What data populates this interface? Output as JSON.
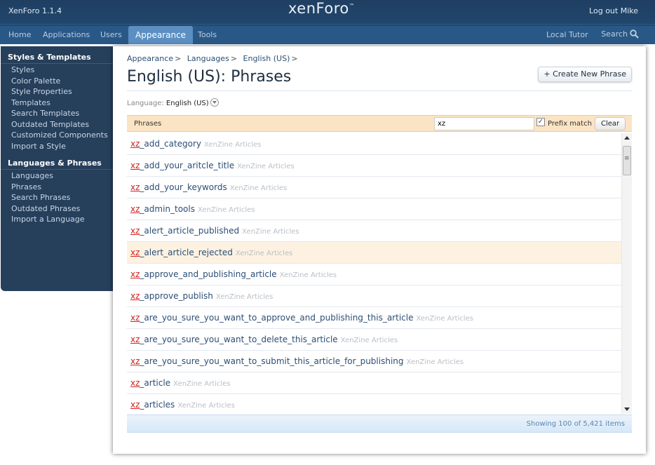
{
  "app": {
    "title": "XenForo 1.1.4",
    "logo": "xenForo",
    "logo_mark": "™",
    "logout": "Log out Mike"
  },
  "tabs": [
    {
      "label": "Home",
      "selected": false
    },
    {
      "label": "Applications",
      "selected": false
    },
    {
      "label": "Users",
      "selected": false
    },
    {
      "label": "Appearance",
      "selected": true
    },
    {
      "label": "Tools",
      "selected": false
    }
  ],
  "header_right": {
    "local_tutor": "Local Tutor",
    "search": "Search"
  },
  "sidebar": {
    "groups": [
      {
        "heading": "Styles & Templates",
        "items": [
          "Styles",
          "Color Palette",
          "Style Properties",
          "Templates",
          "Search Templates",
          "Outdated Templates",
          "Customized Components",
          "Import a Style"
        ]
      },
      {
        "heading": "Languages & Phrases",
        "items": [
          "Languages",
          "Phrases",
          "Search Phrases",
          "Outdated Phrases",
          "Import a Language"
        ]
      }
    ]
  },
  "breadcrumb": [
    "Appearance",
    "Languages",
    "English (US)"
  ],
  "breadcrumb_sep": ">",
  "page_title": "English (US): Phrases",
  "create_button": "+ Create New Phrase",
  "language": {
    "label": "Language:",
    "value": "English (US)"
  },
  "filter": {
    "label": "Phrases",
    "value": "xz",
    "prefix_checked": true,
    "prefix_label": "Prefix match",
    "clear": "Clear"
  },
  "phrases": [
    {
      "prefix": "xz",
      "rest": "_add_category",
      "addon": "XenZine Articles",
      "highlighted": false
    },
    {
      "prefix": "xz",
      "rest": "_add_your_aritcle_title",
      "addon": "XenZine Articles",
      "highlighted": false
    },
    {
      "prefix": "xz",
      "rest": "_add_your_keywords",
      "addon": "XenZine Articles",
      "highlighted": false
    },
    {
      "prefix": "xz",
      "rest": "_admin_tools",
      "addon": "XenZine Articles",
      "highlighted": false
    },
    {
      "prefix": "xz",
      "rest": "_alert_article_published",
      "addon": "XenZine Articles",
      "highlighted": false
    },
    {
      "prefix": "xz",
      "rest": "_alert_article_rejected",
      "addon": "XenZine Articles",
      "highlighted": true
    },
    {
      "prefix": "xz",
      "rest": "_approve_and_publishing_article",
      "addon": "XenZine Articles",
      "highlighted": false
    },
    {
      "prefix": "xz",
      "rest": "_approve_publish",
      "addon": "XenZine Articles",
      "highlighted": false
    },
    {
      "prefix": "xz",
      "rest": "_are_you_sure_you_want_to_approve_and_publishing_this_article",
      "addon": "XenZine Articles",
      "highlighted": false
    },
    {
      "prefix": "xz",
      "rest": "_are_you_sure_you_want_to_delete_this_article",
      "addon": "XenZine Articles",
      "highlighted": false
    },
    {
      "prefix": "xz",
      "rest": "_are_you_sure_you_want_to_submit_this_article_for_publishing",
      "addon": "XenZine Articles",
      "highlighted": false
    },
    {
      "prefix": "xz",
      "rest": "_article",
      "addon": "XenZine Articles",
      "highlighted": false
    },
    {
      "prefix": "xz",
      "rest": "_articles",
      "addon": "XenZine Articles",
      "highlighted": false
    }
  ],
  "footer": "Showing 100 of 5,421 items",
  "colors": {
    "header": "#22466b",
    "tab_selected": "#5b8fc2",
    "sidebar": "#263f5b",
    "filter_bar": "#fbe4c4",
    "highlight_row": "#fdf2e2",
    "prefix_red": "#d21f1f",
    "link_blue": "#2b4e76"
  },
  "icons": {
    "search": "search-icon",
    "dropdown": "chevron-down-icon",
    "checkbox": "checkbox-checked-icon"
  }
}
